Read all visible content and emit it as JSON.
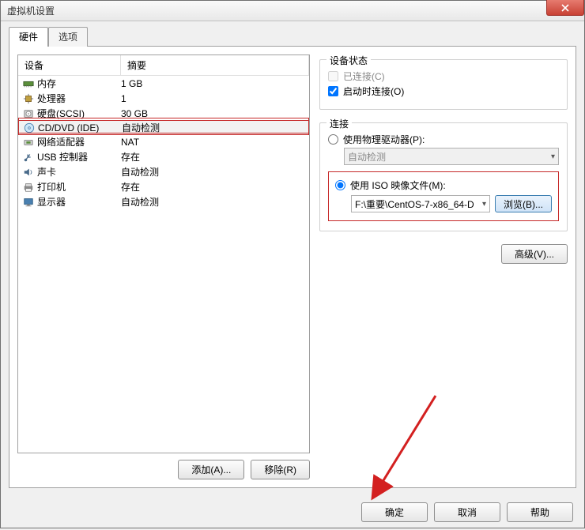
{
  "window": {
    "title": "虚拟机设置"
  },
  "tabs": {
    "hardware": "硬件",
    "options": "选项"
  },
  "list": {
    "header_device": "设备",
    "header_summary": "摘要",
    "rows": [
      {
        "icon": "memory",
        "device": "内存",
        "summary": "1 GB"
      },
      {
        "icon": "cpu",
        "device": "处理器",
        "summary": "1"
      },
      {
        "icon": "disk",
        "device": "硬盘(SCSI)",
        "summary": "30 GB"
      },
      {
        "icon": "cd",
        "device": "CD/DVD (IDE)",
        "summary": "自动检测",
        "selected": true
      },
      {
        "icon": "net",
        "device": "网络适配器",
        "summary": "NAT"
      },
      {
        "icon": "usb",
        "device": "USB 控制器",
        "summary": "存在"
      },
      {
        "icon": "sound",
        "device": "声卡",
        "summary": "自动检测"
      },
      {
        "icon": "printer",
        "device": "打印机",
        "summary": "存在"
      },
      {
        "icon": "display",
        "device": "显示器",
        "summary": "自动检测"
      }
    ]
  },
  "left_buttons": {
    "add": "添加(A)...",
    "remove": "移除(R)"
  },
  "status_group": {
    "title": "设备状态",
    "connected": "已连接(C)",
    "connect_at_poweron": "启动时连接(O)",
    "connected_checked": false,
    "poweron_checked": true
  },
  "connection_group": {
    "title": "连接",
    "use_physical": "使用物理驱动器(P):",
    "physical_value": "自动检测",
    "use_iso": "使用 ISO 映像文件(M):",
    "iso_value": "F:\\重要\\CentOS-7-x86_64-D",
    "browse": "浏览(B)...",
    "selected": "iso"
  },
  "advanced": "高级(V)...",
  "footer": {
    "ok": "确定",
    "cancel": "取消",
    "help": "帮助"
  }
}
